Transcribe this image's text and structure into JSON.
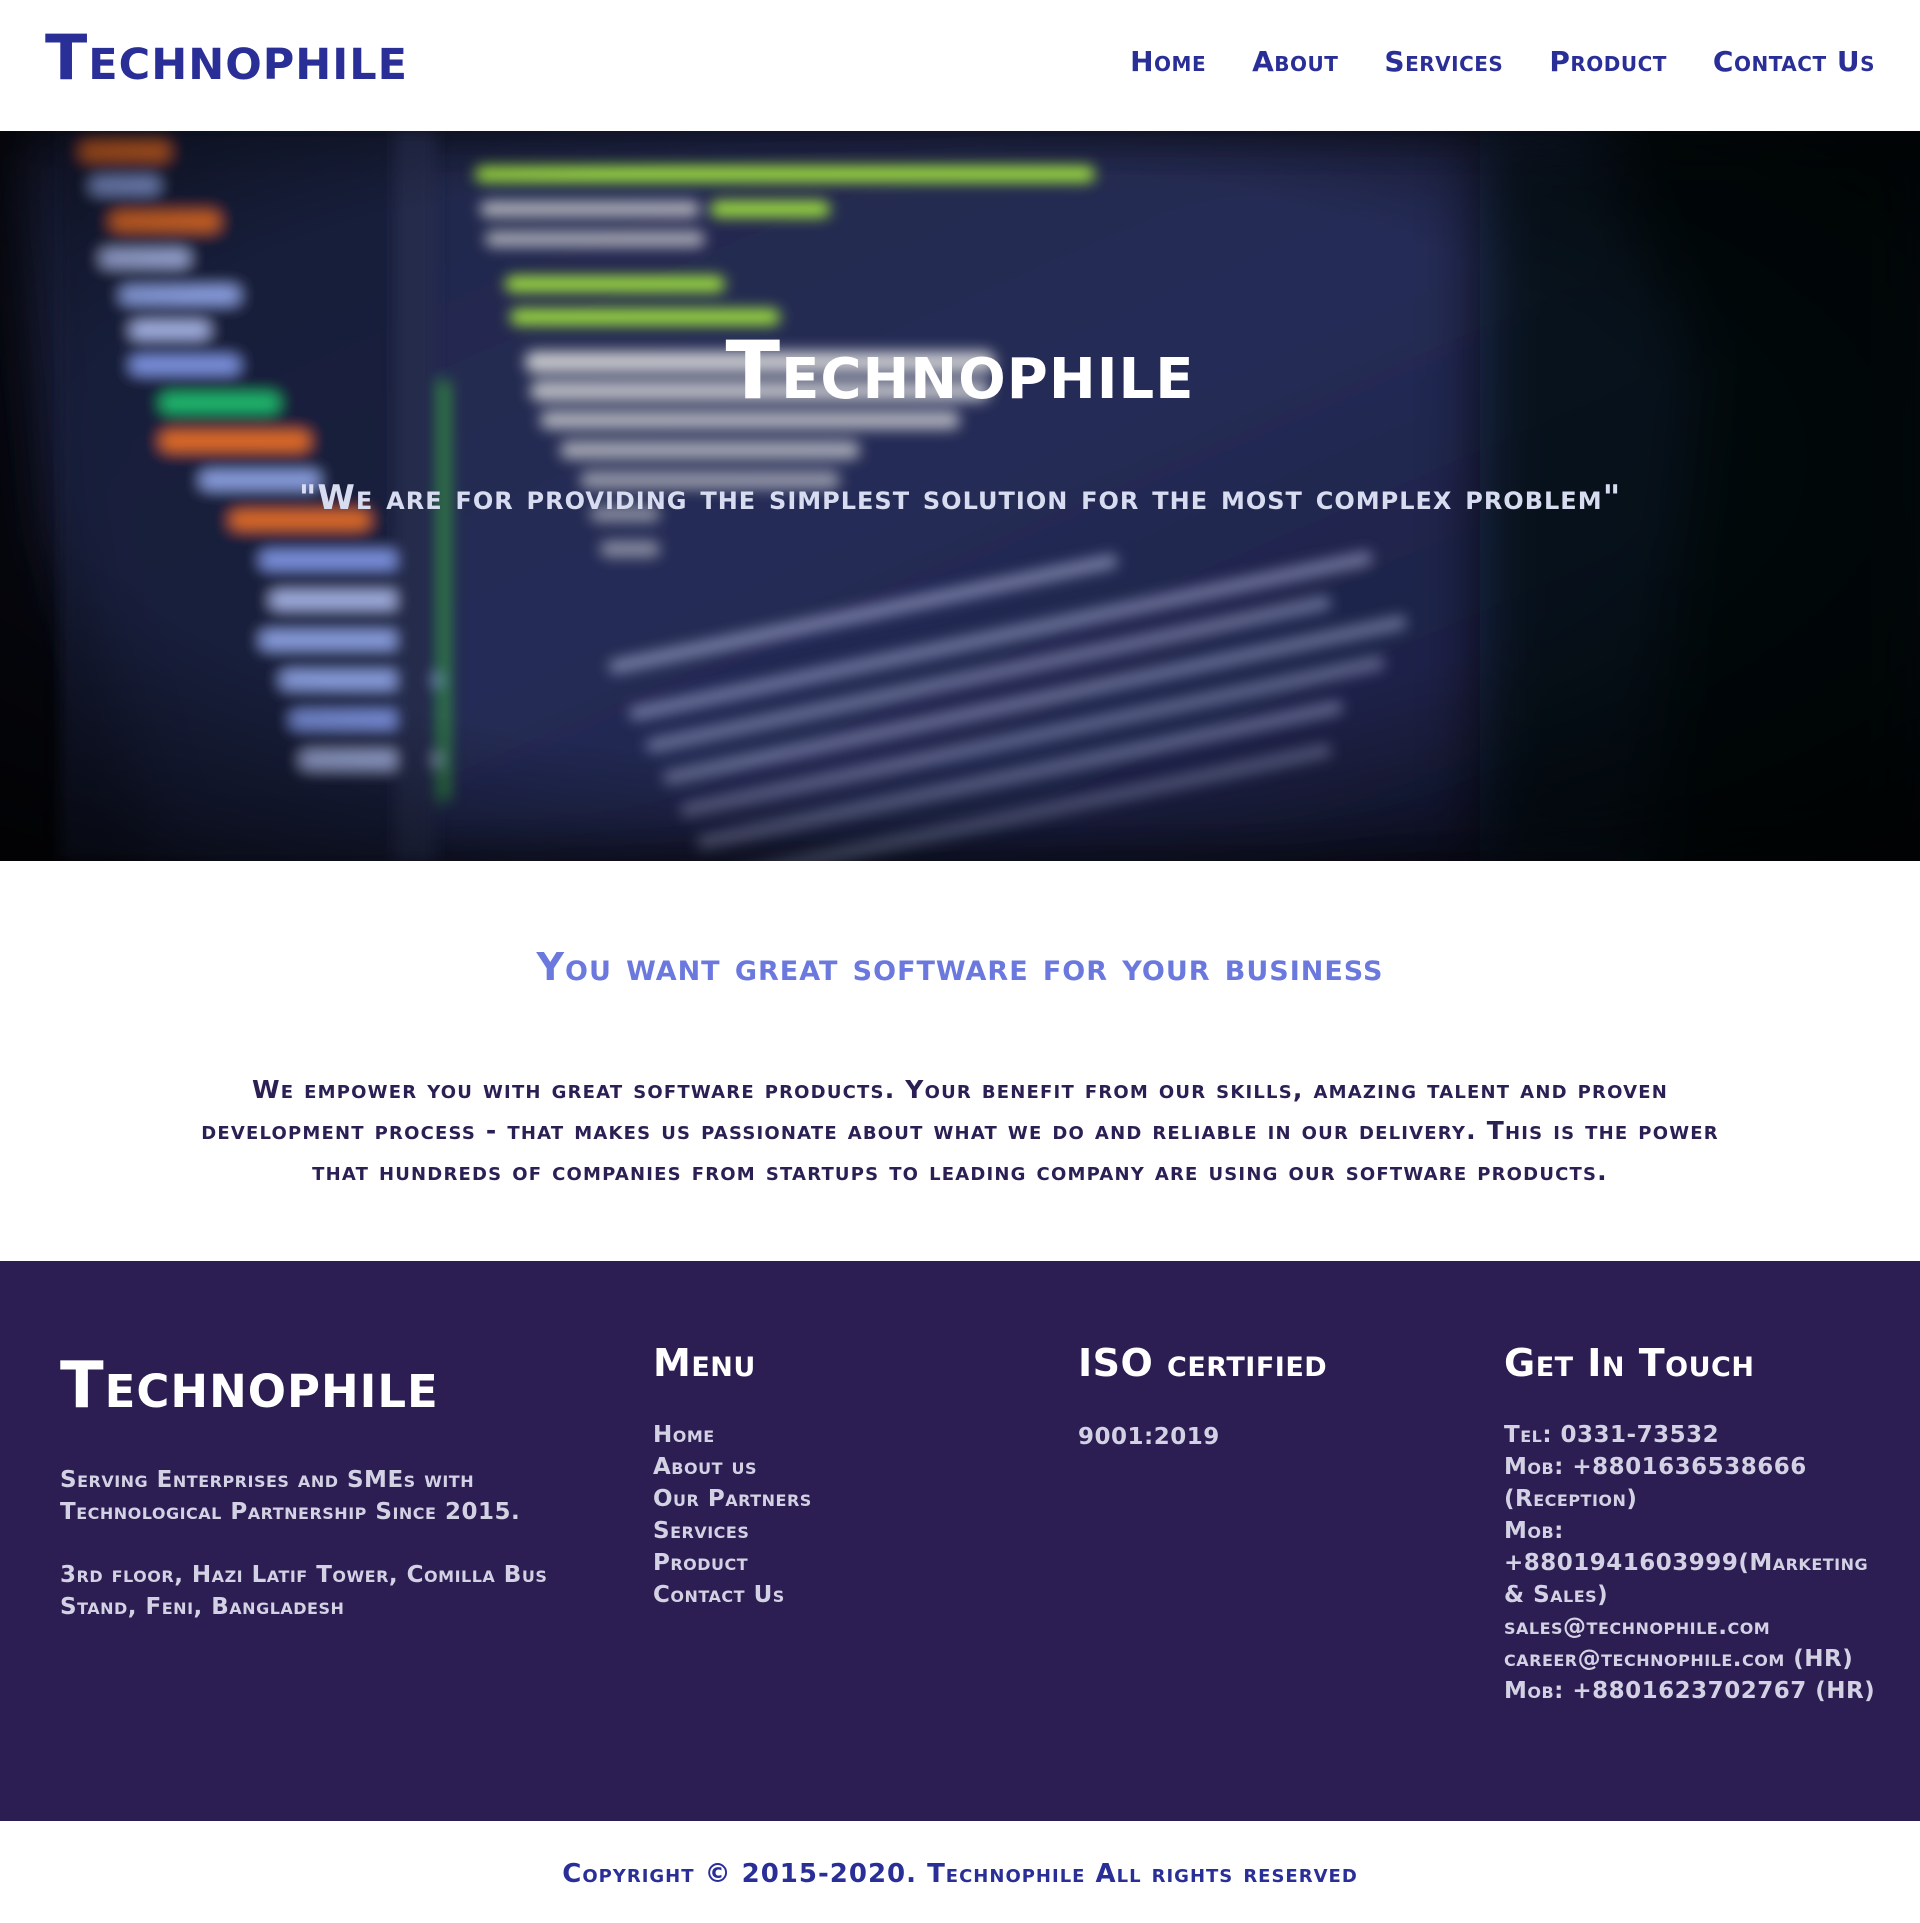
{
  "header": {
    "brand": "Technophile",
    "nav": [
      "Home",
      "About",
      "Services",
      "Product",
      "Contact Us"
    ]
  },
  "hero": {
    "title": "Technophile",
    "tagline": "\"We are for providing the simplest solution for the most complex problem\""
  },
  "intro": {
    "heading": "You want great software for your business",
    "text": "We empower you with great software products. Your benefit from our skills, amazing talent and proven development process - that makes us passionate about what we do and reliable in our delivery. This is the power that hundreds of companies from startups to leading company are using our software products."
  },
  "footer": {
    "brand": "Technophile",
    "serving": "Serving Enterprises and SMEs with Technological Partnership Since 2015.",
    "address": "3rd floor, Hazi Latif Tower, Comilla Bus Stand, Feni, Bangladesh",
    "menu_heading": "Menu",
    "menu_items": [
      "Home",
      "About us",
      "Our Partners",
      "Services",
      "Product",
      "Contact Us"
    ],
    "iso_heading": "ISO certified",
    "iso_value": "9001:2019",
    "contact_heading": "Get In Touch",
    "contact_lines": [
      "Tel: 0331-73532",
      "Mob: +8801636538666 (Reception)",
      "Mob: +8801941603999(Marketing & Sales)",
      "sales@technophile.com",
      "career@technophile.com (HR)",
      "Mob: +8801623702767 (HR)"
    ]
  },
  "copyright": "Copyright © 2015-2020. Technophile All rights reserved",
  "colors": {
    "brand": "#2a2f97",
    "intro_heading": "#6b78dd",
    "intro_text": "#2b1f54",
    "footer_bg": "#2c1d52",
    "footer_text": "#d3d1e4"
  }
}
